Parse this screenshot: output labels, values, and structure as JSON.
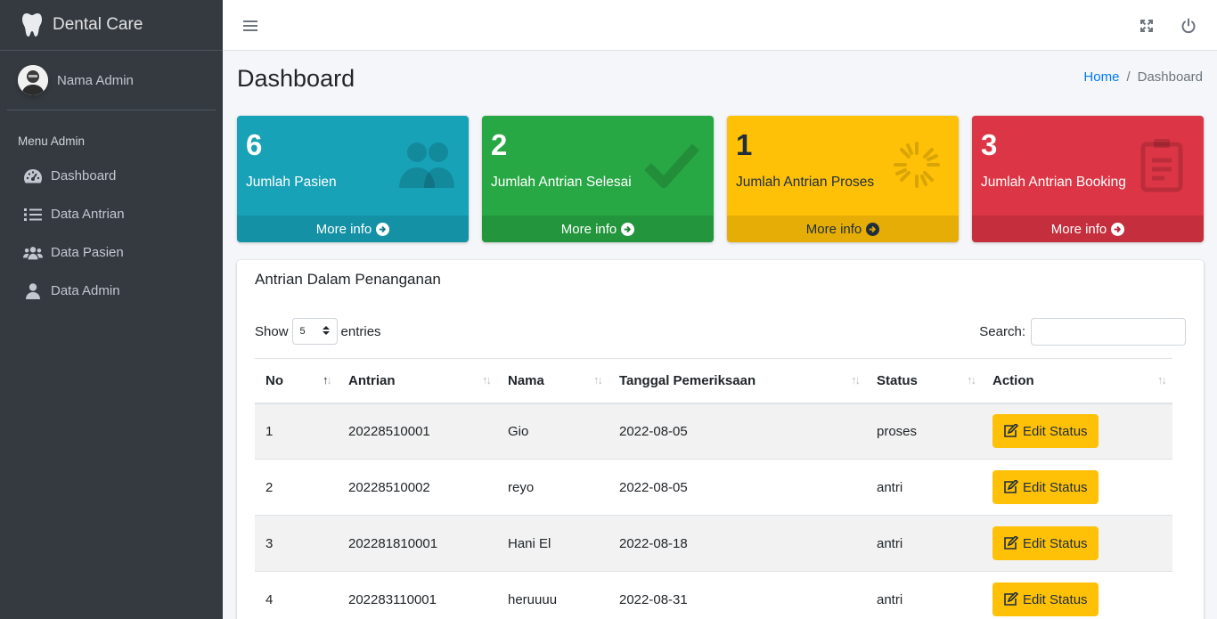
{
  "brand": {
    "name": "Dental Care",
    "icon": "tooth-icon"
  },
  "user": {
    "name": "Nama Admin"
  },
  "sidebar": {
    "header": "Menu Admin",
    "items": [
      {
        "label": "Dashboard",
        "icon": "tachometer-icon"
      },
      {
        "label": "Data Antrian",
        "icon": "list-icon"
      },
      {
        "label": "Data Pasien",
        "icon": "users-icon"
      },
      {
        "label": "Data Admin",
        "icon": "user-icon"
      }
    ]
  },
  "page": {
    "title": "Dashboard",
    "breadcrumb": {
      "home": "Home",
      "separator": "/",
      "current": "Dashboard"
    }
  },
  "stats": [
    {
      "value": "6",
      "label": "Jumlah Pasien",
      "more": "More info",
      "color": "#17a2b8",
      "icon": "users-icon"
    },
    {
      "value": "2",
      "label": "Jumlah Antrian Selesai",
      "more": "More info",
      "color": "#28a745",
      "icon": "check-icon"
    },
    {
      "value": "1",
      "label": "Jumlah Antrian Proses",
      "more": "More info",
      "color": "#ffc107",
      "icon": "spinner-icon"
    },
    {
      "value": "3",
      "label": "Jumlah Antrian Booking",
      "more": "More info",
      "color": "#dc3545",
      "icon": "clipboard-list-icon"
    }
  ],
  "table_card": {
    "title": "Antrian Dalam Penanganan",
    "show_label": "Show",
    "show_value": "5",
    "entries_label": "entries",
    "search_label": "Search:",
    "columns": [
      "No",
      "Antrian",
      "Nama",
      "Tanggal Pemeriksaan",
      "Status",
      "Action"
    ],
    "action_label": "Edit Status",
    "rows": [
      {
        "no": "1",
        "antrian": "20228510001",
        "nama": "Gio",
        "tanggal": "2022-08-05",
        "status": "proses"
      },
      {
        "no": "2",
        "antrian": "20228510002",
        "nama": "reyo",
        "tanggal": "2022-08-05",
        "status": "antri"
      },
      {
        "no": "3",
        "antrian": "202281810001",
        "nama": "Hani El",
        "tanggal": "2022-08-18",
        "status": "antri"
      },
      {
        "no": "4",
        "antrian": "202283110001",
        "nama": "heruuuu",
        "tanggal": "2022-08-31",
        "status": "antri"
      }
    ]
  }
}
